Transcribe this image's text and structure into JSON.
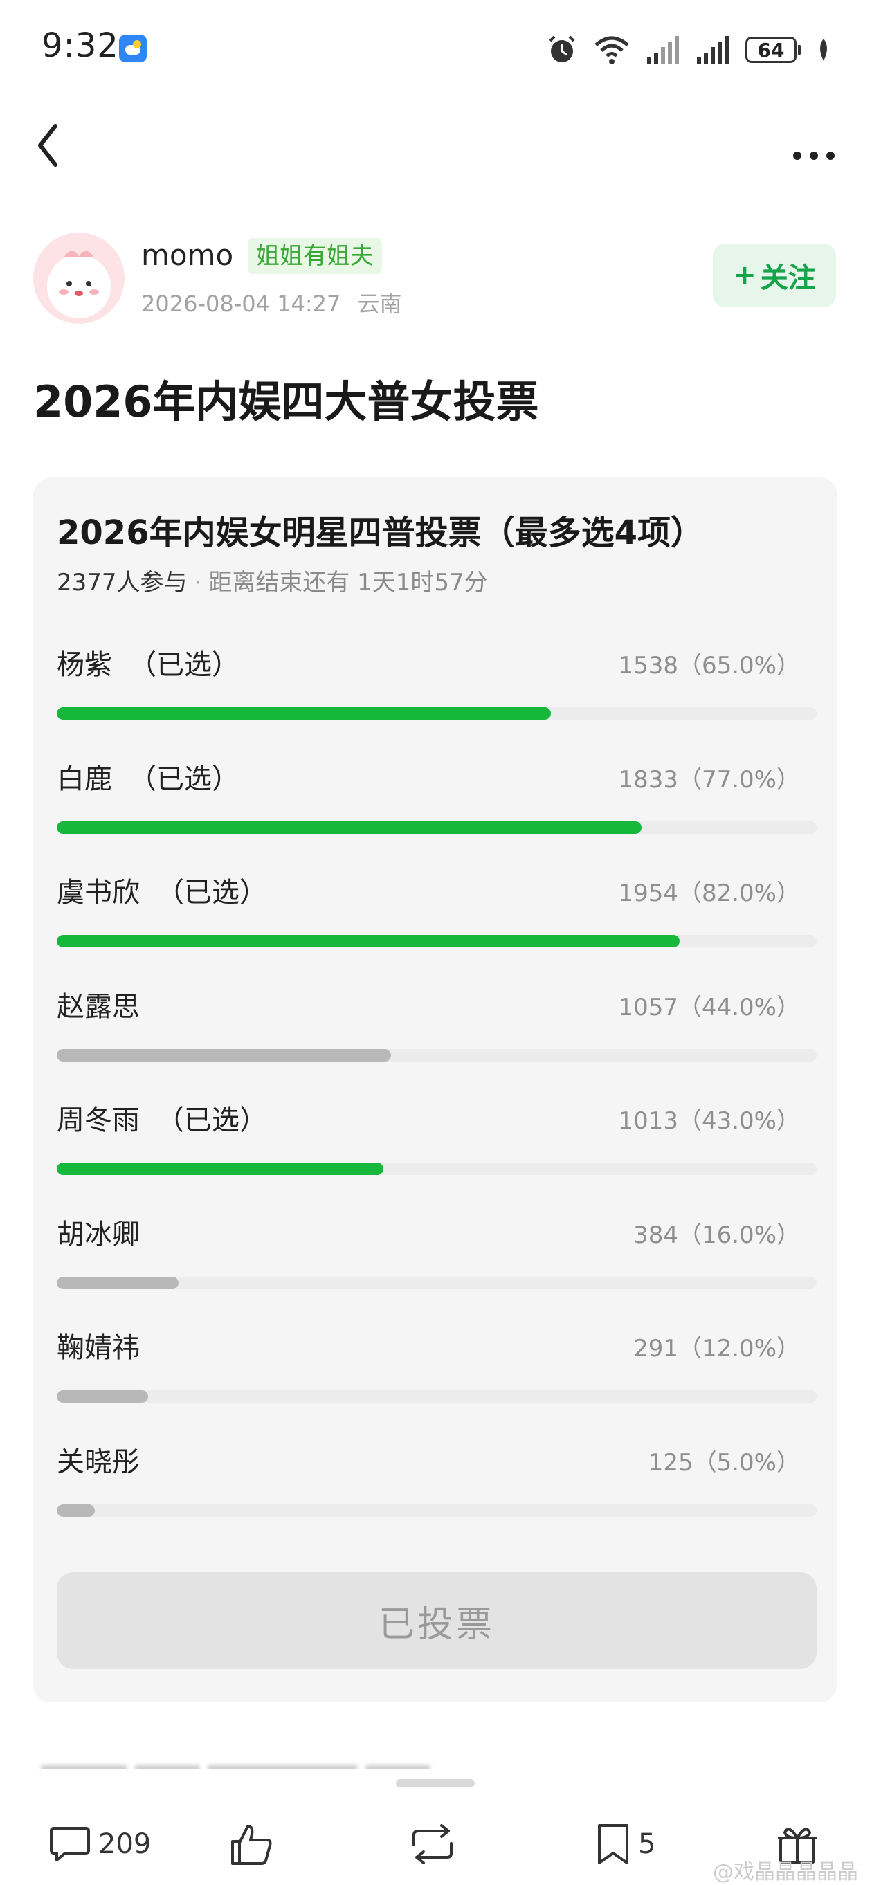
{
  "status_bar": {
    "time": "9:32",
    "battery": "64"
  },
  "author": {
    "name": "momo",
    "badge": "姐姐有姐夫",
    "date": "2026-08-04 14:27",
    "location": "云南",
    "follow_label": "关注"
  },
  "post": {
    "title": "2026年内娱四大普女投票"
  },
  "poll": {
    "title": "2026年内娱女明星四普投票（最多选4项）",
    "participants": "2377人参与",
    "remaining": "距离结束还有 1天1时57分",
    "selected_text": "（已选）",
    "options": [
      {
        "name": "杨紫",
        "count": "1538（65.0%）",
        "percent": 65.0,
        "selected": true
      },
      {
        "name": "白鹿",
        "count": "1833（77.0%）",
        "percent": 77.0,
        "selected": true
      },
      {
        "name": "虞书欣",
        "count": "1954（82.0%）",
        "percent": 82.0,
        "selected": true
      },
      {
        "name": "赵露思",
        "count": "1057（44.0%）",
        "percent": 44.0,
        "selected": false
      },
      {
        "name": "周冬雨",
        "count": "1013（43.0%）",
        "percent": 43.0,
        "selected": true
      },
      {
        "name": "胡冰卿",
        "count": "384（16.0%）",
        "percent": 16.0,
        "selected": false
      },
      {
        "name": "鞠婧祎",
        "count": "291（12.0%）",
        "percent": 12.0,
        "selected": false
      },
      {
        "name": "关晓彤",
        "count": "125（5.0%）",
        "percent": 5.0,
        "selected": false
      }
    ],
    "voted_label": "已投票"
  },
  "bottom_bar": {
    "comments": "209",
    "bookmarks": "5"
  },
  "watermark": "@戏晶晶晶晶晶",
  "colors": {
    "accent_green": "#16b83c",
    "unselected_gray": "#b8b8b8"
  }
}
